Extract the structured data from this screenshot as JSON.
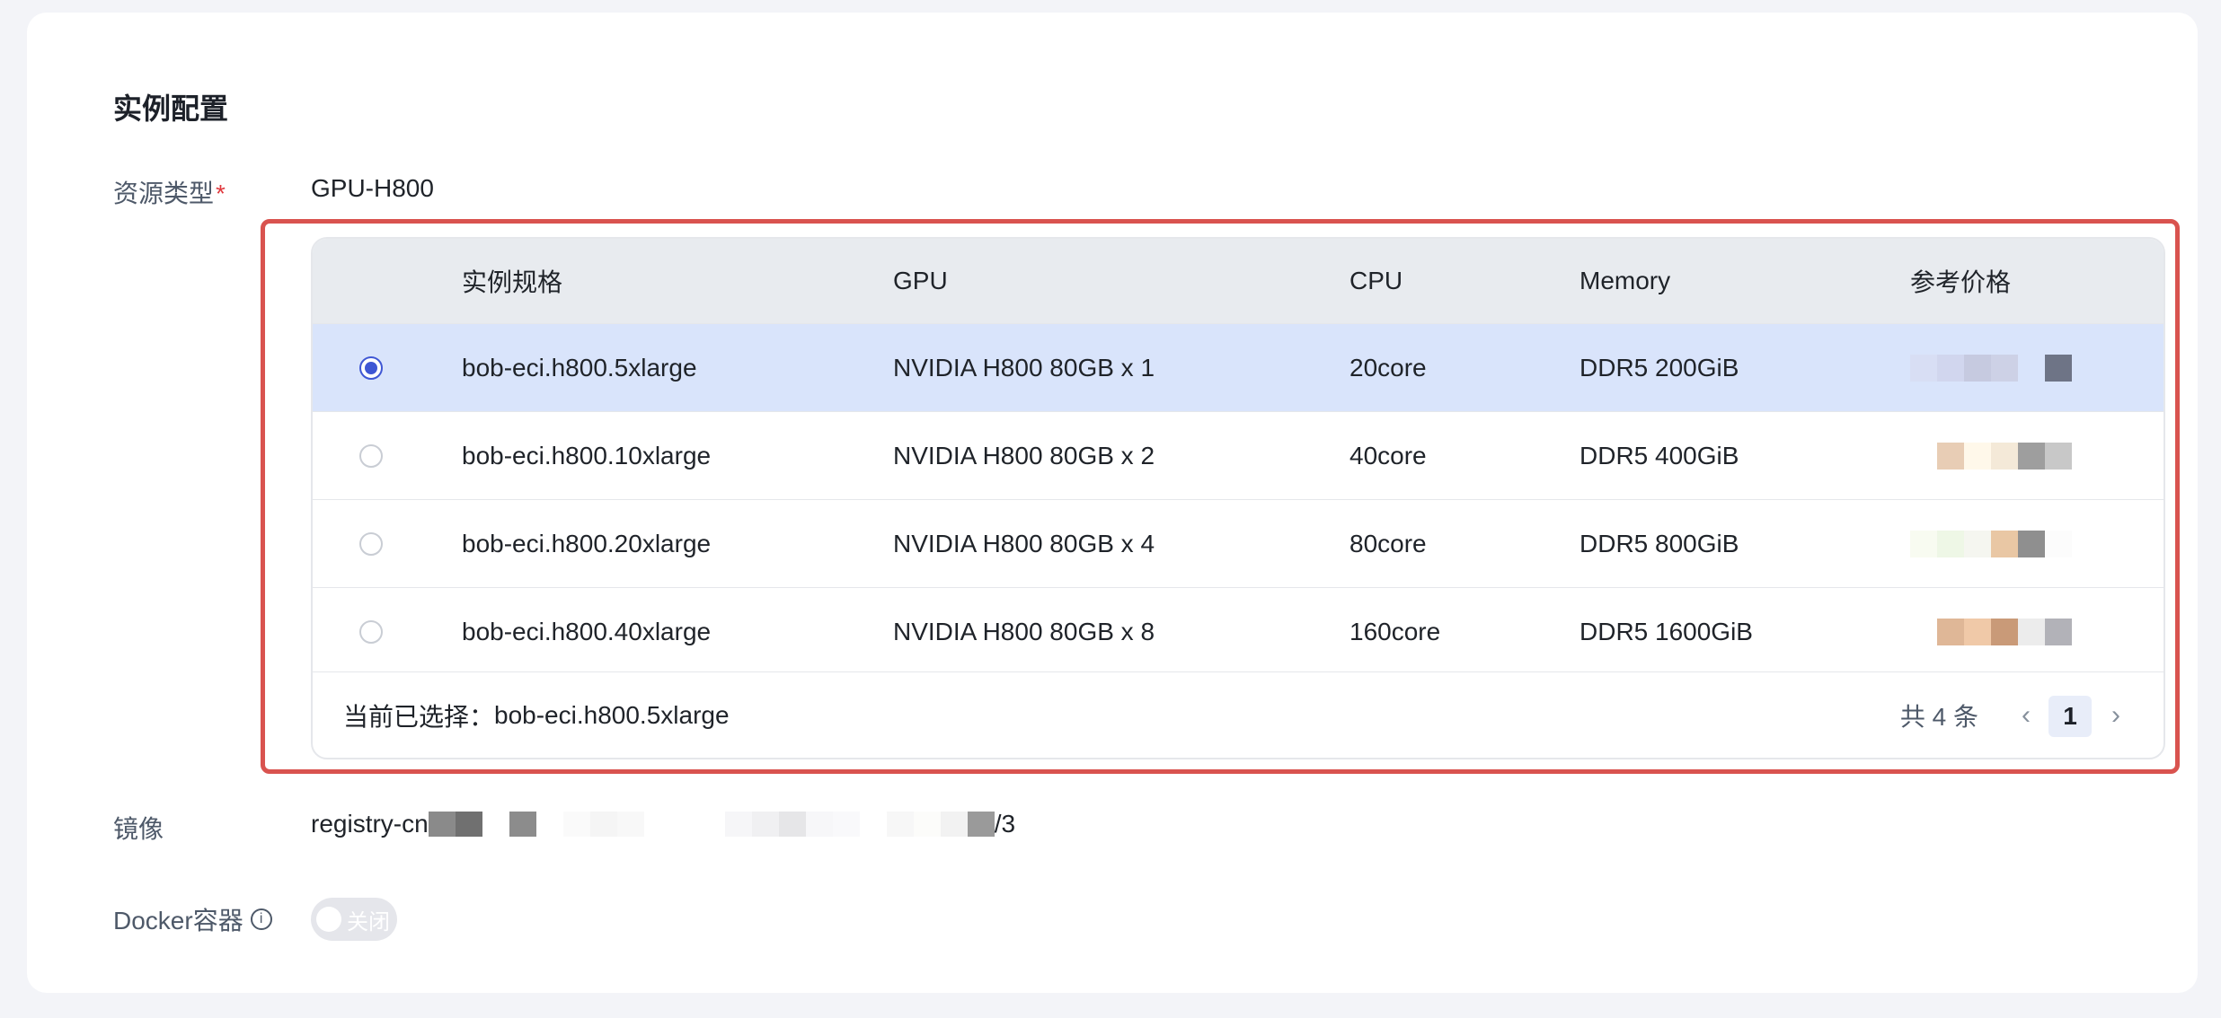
{
  "section": {
    "title": "实例配置"
  },
  "resource": {
    "label": "资源类型",
    "required_mark": "*",
    "value": "GPU-H800"
  },
  "table": {
    "headers": [
      "实例规格",
      "GPU",
      "CPU",
      "Memory",
      "参考价格"
    ],
    "rows": [
      {
        "spec": "bob-eci.h800.5xlarge",
        "gpu": "NVIDIA H800 80GB x 1",
        "cpu": "20core",
        "memory": "DDR5 200GiB",
        "selected": true
      },
      {
        "spec": "bob-eci.h800.10xlarge",
        "gpu": "NVIDIA H800 80GB x 2",
        "cpu": "40core",
        "memory": "DDR5 400GiB",
        "selected": false
      },
      {
        "spec": "bob-eci.h800.20xlarge",
        "gpu": "NVIDIA H800 80GB x 4",
        "cpu": "80core",
        "memory": "DDR5 800GiB",
        "selected": false
      },
      {
        "spec": "bob-eci.h800.40xlarge",
        "gpu": "NVIDIA H800 80GB x 8",
        "cpu": "160core",
        "memory": "DDR5 1600GiB",
        "selected": false
      }
    ],
    "footer": {
      "selected_prefix": "当前已选择：",
      "selected_value": "bob-eci.h800.5xlarge",
      "total": "共 4 条",
      "current_page": "1"
    }
  },
  "image": {
    "label": "镜像",
    "value_start": "registry-cn",
    "value_end": "/3"
  },
  "docker": {
    "label": "Docker容器",
    "toggle_text": "关闭",
    "enabled": false
  },
  "colors": {
    "accent": "#3f57d4",
    "highlight_border": "#d9534f",
    "selected_row": "#d9e4fb"
  }
}
